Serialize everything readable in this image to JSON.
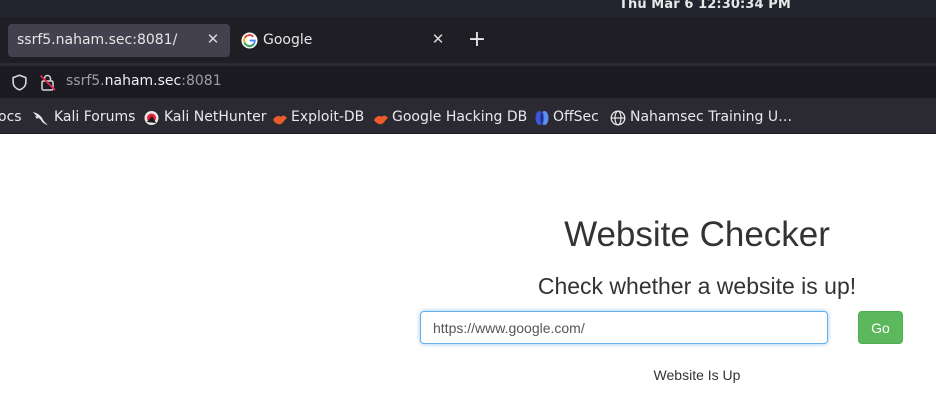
{
  "os": {
    "clock": "Thu Mar 6  12:30:34 PM"
  },
  "tabs": [
    {
      "title": "ssrf5.naham.sec:8081/",
      "active": true,
      "close": "✕"
    },
    {
      "title": "Google",
      "active": false,
      "close": "✕",
      "icon": "google-g-icon"
    }
  ],
  "new_tab": "+",
  "address_bar": {
    "host_prefix": "ssrf5.",
    "host_main": "naham.sec",
    "port": ":8081"
  },
  "bookmarks": [
    {
      "label": "ocs",
      "icon": null
    },
    {
      "label": "Kali Forums",
      "icon": "kali-dragon-icon"
    },
    {
      "label": "Kali NetHunter",
      "icon": "nethunter-icon"
    },
    {
      "label": "Exploit-DB",
      "icon": "exploit-db-icon"
    },
    {
      "label": "Google Hacking DB",
      "icon": "ghdb-icon"
    },
    {
      "label": "OffSec",
      "icon": "offsec-icon"
    },
    {
      "label": "Nahamsec Training U…",
      "icon": "globe-icon"
    }
  ],
  "page": {
    "title": "Website Checker",
    "subtitle": "Check whether a website is up!",
    "url_value": "https://www.google.com/",
    "go_label": "Go",
    "status": "Website Is Up"
  },
  "colors": {
    "os_bar": "#23252e",
    "tab_strip": "#1f1e25",
    "active_tab": "#42414d",
    "toolbar": "#2b2a33",
    "go_button": "#5cb85c",
    "input_focus": "#66afe9"
  }
}
